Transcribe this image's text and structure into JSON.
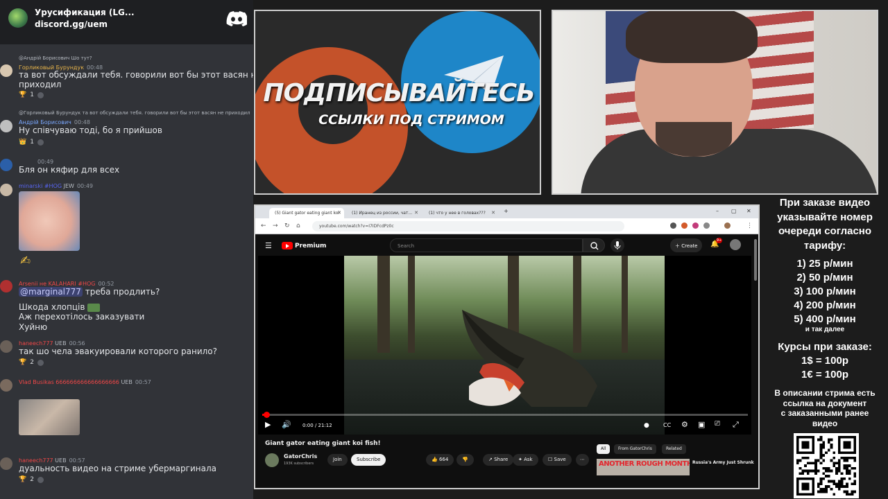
{
  "discord": {
    "server_name": "Урусификация (LG...",
    "invite": "discord.gg/uem",
    "messages": [
      {
        "reply": "@Андрій Борисович Шо тут?",
        "user": "Горликовый Бурундук",
        "user_color": "#e9b54a",
        "time": "00:48",
        "lines": [
          "та вот обсуждали тебя. говорили вот бы этот васян не",
          "приходил"
        ],
        "reaction_emoji": "🏆",
        "reaction_count": "1"
      },
      {
        "reply": "@Горликовый Бурундук та вот обсуждали тебя. говорили вот бы этот васян не приходил",
        "user": "Андрій Борисович",
        "user_color": "#7aa8ff",
        "time": "00:48",
        "lines": [
          "Ну співчуваю тоді, бо я прийшов"
        ],
        "reaction_emoji": "👑",
        "reaction_count": "1"
      },
      {
        "user": "",
        "user_color": "#b5bac1",
        "time": "00:49",
        "lines": [
          "Бля он кяфир для всех"
        ]
      },
      {
        "user": "minarski #HOG",
        "user_color": "#5865f2",
        "badge": "JEW",
        "time": "00:49",
        "lines": [],
        "sticker": "✍"
      },
      {
        "user": "Arsenii не KALAHARI #HOG",
        "user_color": "#f04747",
        "time": "00:52",
        "mention": "@marginal777",
        "lines": [
          "треба продлить?",
          "Шкода хлопців",
          "Аж перехотілось заказувати",
          "Хуйню"
        ]
      },
      {
        "user": "haneech777",
        "user_color": "#f04747",
        "badge": "UEB",
        "time": "00:56",
        "lines": [
          "так шо чела эвакуировали которого ранило?"
        ],
        "reaction_emoji": "🏆",
        "reaction_count": "2"
      },
      {
        "user": "Vlad Busikas 666666666666666666",
        "user_color": "#f04747",
        "badge": "UEB",
        "time": "00:57",
        "lines": []
      },
      {
        "user": "haneech777",
        "user_color": "#f04747",
        "badge": "UEB",
        "time": "00:57",
        "lines": [
          "дуальность видео на стриме убермаргинала"
        ],
        "reaction_emoji": "🏆",
        "reaction_count": "2"
      }
    ]
  },
  "promo": {
    "title": "ПОДПИСЫВАЙТЕСЬ",
    "subtitle": "ССЫЛКИ ПОД СТРИМОМ"
  },
  "browser": {
    "tabs": [
      "(5) Giant gator eating giant koi",
      "(1) Иранец из россии, чат...",
      "(1) что у нее в головах???"
    ],
    "url": "youtube.com/watch?v=I7IDFcdPz0c"
  },
  "youtube": {
    "brand": "Premium",
    "search_placeholder": "Search",
    "create_label": "Create",
    "notifications": "9+",
    "time": "0:00 / 21:12",
    "progress_fraction": 0.01,
    "title": "Giant gator eating giant koi fish!",
    "channel": "GatorChris",
    "subscribers": "193K subscribers",
    "join_label": "Join",
    "subscribe_label": "Subscribe",
    "likes": "664",
    "share_label": "Share",
    "ask_label": "Ask",
    "save_label": "Save",
    "filters": [
      "All",
      "From GatorChris",
      "Related"
    ],
    "rec_thumb_text": "ANOTHER ROUGH MONTH",
    "rec_title": "Russia's Army Just Shrunk"
  },
  "info": {
    "order_text": [
      "При заказе видео",
      "указывайте номер",
      "очереди согласно",
      "тарифу:"
    ],
    "tariffs": [
      "1) 25 р/мин",
      "2) 50 р/мин",
      "3) 100 р/мин",
      "4) 200 р/мин",
      "5) 400 р/мин"
    ],
    "etc": "и так далее",
    "courses": [
      "Курсы при заказе:",
      "1$ = 100р",
      "1€ = 100р"
    ],
    "description": [
      "В описании стрима есть",
      "ссылка на документ",
      "с заказанными ранее",
      "видео"
    ]
  }
}
